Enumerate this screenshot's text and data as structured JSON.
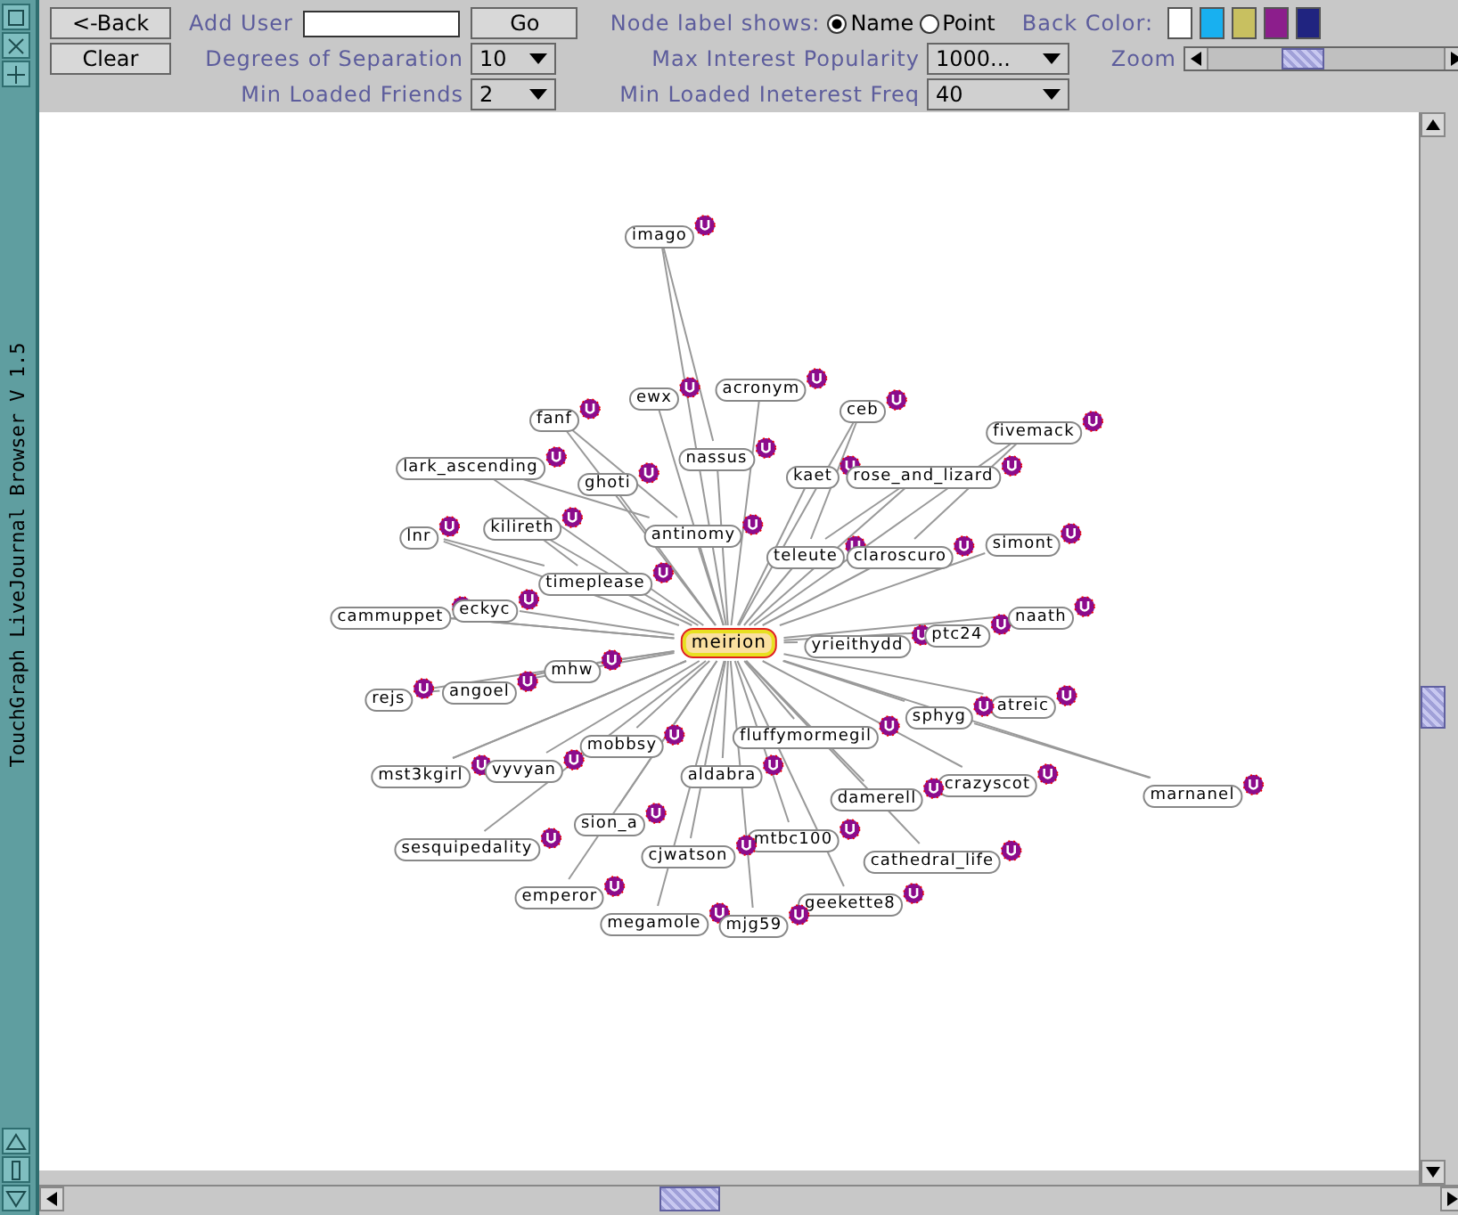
{
  "side_title": "TouchGraph LiveJournal Browser V 1.5",
  "toolbar": {
    "back_button": "<-Back",
    "add_user": {
      "label": "Add User"
    },
    "go_button": "Go",
    "node_label": {
      "label": "Node label shows:",
      "options": [
        {
          "label": "Name",
          "selected": true
        },
        {
          "label": "Point",
          "selected": false
        }
      ]
    },
    "back_color": {
      "label": "Back Color:",
      "swatches": [
        {
          "color": "#ffffff",
          "selected": false
        },
        {
          "color": "#18b0f0",
          "selected": false
        },
        {
          "color": "#c8c060",
          "selected": false
        },
        {
          "color": "#8c1e8c",
          "selected": false
        },
        {
          "color": "#202480",
          "selected": false
        }
      ]
    },
    "clear_button": "Clear",
    "controls": [
      {
        "kind": "select",
        "label": "Degrees of Separation",
        "value": "10"
      },
      {
        "kind": "select",
        "label": "Max Interest Popularity",
        "value": "1000..."
      },
      {
        "kind": "slider",
        "label": "Zoom",
        "level": 0.4
      },
      {
        "kind": "select",
        "label": "Min Loaded Friends",
        "value": "2"
      },
      {
        "kind": "select",
        "label": "Min Loaded Ineterest Freq",
        "value": "40"
      }
    ]
  },
  "graph": {
    "nodes": [
      {
        "name": "imago",
        "selected": false
      },
      {
        "name": "ewx",
        "selected": false
      },
      {
        "name": "acronym",
        "selected": false
      },
      {
        "name": "fanf",
        "selected": false
      },
      {
        "name": "ceb",
        "selected": false
      },
      {
        "name": "fivemack",
        "selected": false
      },
      {
        "name": "lark_ascending",
        "selected": false
      },
      {
        "name": "nassus",
        "selected": false
      },
      {
        "name": "ghoti",
        "selected": false
      },
      {
        "name": "kaet",
        "selected": false
      },
      {
        "name": "rose_and_lizard",
        "selected": false
      },
      {
        "name": "lnr",
        "selected": false
      },
      {
        "name": "kilireth",
        "selected": false
      },
      {
        "name": "antinomy",
        "selected": false
      },
      {
        "name": "simont",
        "selected": false
      },
      {
        "name": "teleute",
        "selected": false
      },
      {
        "name": "claroscuro",
        "selected": false
      },
      {
        "name": "timeplease",
        "selected": false
      },
      {
        "name": "cammuppet",
        "selected": false
      },
      {
        "name": "eckyc",
        "selected": false
      },
      {
        "name": "meirion",
        "selected": true
      },
      {
        "name": "yrieithydd",
        "selected": false
      },
      {
        "name": "ptc24",
        "selected": false
      },
      {
        "name": "naath",
        "selected": false
      },
      {
        "name": "mhw",
        "selected": false
      },
      {
        "name": "angoel",
        "selected": false
      },
      {
        "name": "rejs",
        "selected": false
      },
      {
        "name": "atreic",
        "selected": false
      },
      {
        "name": "sphyg",
        "selected": false
      },
      {
        "name": "fluffymormegil",
        "selected": false
      },
      {
        "name": "mobbsy",
        "selected": false
      },
      {
        "name": "mst3kgirl",
        "selected": false
      },
      {
        "name": "vyvyan",
        "selected": false
      },
      {
        "name": "aldabra",
        "selected": false
      },
      {
        "name": "crazyscot",
        "selected": false
      },
      {
        "name": "damerell",
        "selected": false
      },
      {
        "name": "marnanel",
        "selected": false
      },
      {
        "name": "sion_a",
        "selected": false
      },
      {
        "name": "sesquipedality",
        "selected": false
      },
      {
        "name": "mtbc100",
        "selected": false
      },
      {
        "name": "cjwatson",
        "selected": false
      },
      {
        "name": "cathedral_life",
        "selected": false
      },
      {
        "name": "emperor",
        "selected": false
      },
      {
        "name": "geekette8",
        "selected": false
      },
      {
        "name": "megamole",
        "selected": false
      },
      {
        "name": "mjg59",
        "selected": false
      }
    ]
  }
}
